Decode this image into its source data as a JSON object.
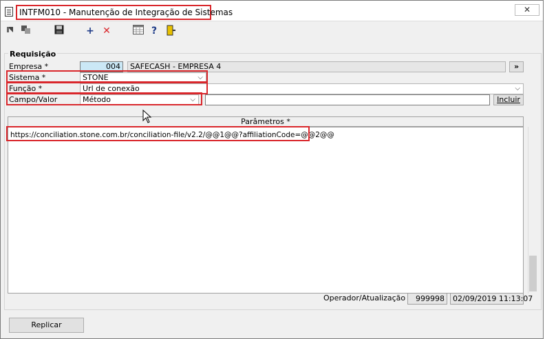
{
  "window": {
    "title": "INTFM010 - Manutenção de Integração de Sistemas",
    "close_icon": "close-icon"
  },
  "toolbar": {
    "icons": [
      "first-record-icon",
      "copy-icon",
      "save-icon",
      "add-icon",
      "delete-icon",
      "calendar-icon",
      "help-icon",
      "exit-icon"
    ]
  },
  "form": {
    "group_label": "Requisição",
    "empresa": {
      "label": "Empresa *",
      "code": "004",
      "name": "SAFECASH -  EMPRESA 4",
      "lookup_label": "»"
    },
    "sistema": {
      "label": "Sistema *",
      "value": "STONE"
    },
    "funcao": {
      "label": "Função *",
      "value": "Url de conexão"
    },
    "campo_valor": {
      "label": "Campo/Valor",
      "value": "Método",
      "text": "",
      "incluir_label": "Incluir"
    }
  },
  "params": {
    "header": "Parâmetros *",
    "value": "https://conciliation.stone.com.br/conciliation-file/v2.2/@@1@@?affiliationCode=@@2@@"
  },
  "footer": {
    "operador_label": "Operador/Atualização",
    "operador": "999998",
    "atualizacao": "02/09/2019 11:13:07",
    "replicar_label": "Replicar"
  },
  "colors": {
    "highlight": "#d9262b",
    "code_field_bg": "#cbe8f6",
    "delete": "#d9262b",
    "add": "#1f3c88"
  }
}
